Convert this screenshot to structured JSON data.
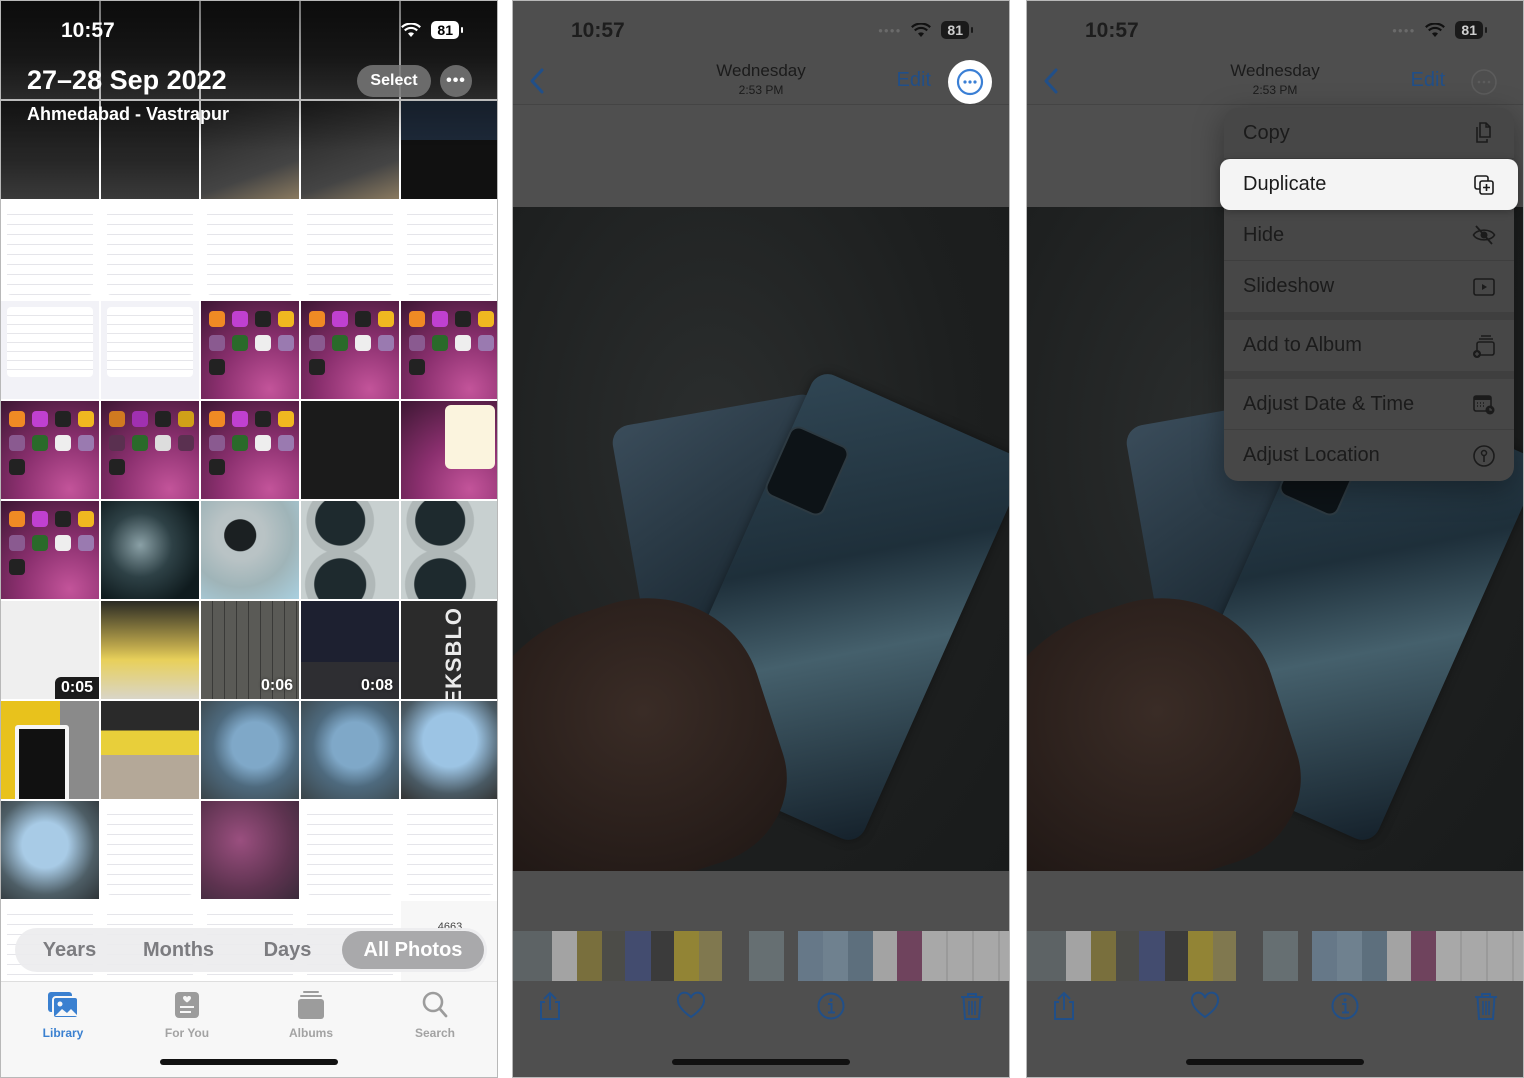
{
  "status_bar": {
    "time": "10:57",
    "battery": "81"
  },
  "library_screen": {
    "title": "27–28 Sep 2022",
    "location": "Ahmedabad - Vastrapur",
    "select_label": "Select",
    "more_label": "•••",
    "video_durations": [
      "0:05",
      "0:06",
      "0:08"
    ],
    "tile_text": {
      "geeks": "GEEKSBLO",
      "counter": "4663"
    },
    "segments": [
      {
        "label": "Years",
        "active": false
      },
      {
        "label": "Months",
        "active": false
      },
      {
        "label": "Days",
        "active": false
      },
      {
        "label": "All Photos",
        "active": true
      }
    ],
    "tabs": [
      {
        "label": "Library",
        "icon": "library-icon",
        "active": true
      },
      {
        "label": "For You",
        "icon": "for-you-icon",
        "active": false
      },
      {
        "label": "Albums",
        "icon": "albums-icon",
        "active": false
      },
      {
        "label": "Search",
        "icon": "search-icon",
        "active": false
      }
    ]
  },
  "photo_viewer": {
    "day": "Wednesday",
    "time": "2:53 PM",
    "edit_label": "Edit",
    "toolbar": [
      "share-icon",
      "heart-icon",
      "info-icon",
      "trash-icon"
    ]
  },
  "context_menu": {
    "items": [
      {
        "label": "Copy",
        "icon": "copy-icon",
        "highlighted": false
      },
      {
        "label": "Duplicate",
        "icon": "duplicate-icon",
        "highlighted": true
      },
      {
        "label": "Hide",
        "icon": "eye-slash-icon",
        "highlighted": false
      },
      {
        "label": "Slideshow",
        "icon": "play-rectangle-icon",
        "highlighted": false
      },
      {
        "label": "Add to Album",
        "icon": "add-to-album-icon",
        "highlighted": false
      },
      {
        "label": "Adjust Date & Time",
        "icon": "calendar-clock-icon",
        "highlighted": false
      },
      {
        "label": "Adjust Location",
        "icon": "location-pin-icon",
        "highlighted": false
      }
    ]
  },
  "colors": {
    "accent_blue": "#3a80d0",
    "dim_blue": "#214f88",
    "overlay_gray": "#4f4f4f",
    "menu_bg": "#474747",
    "menu_highlight": "#f4f4f4"
  }
}
